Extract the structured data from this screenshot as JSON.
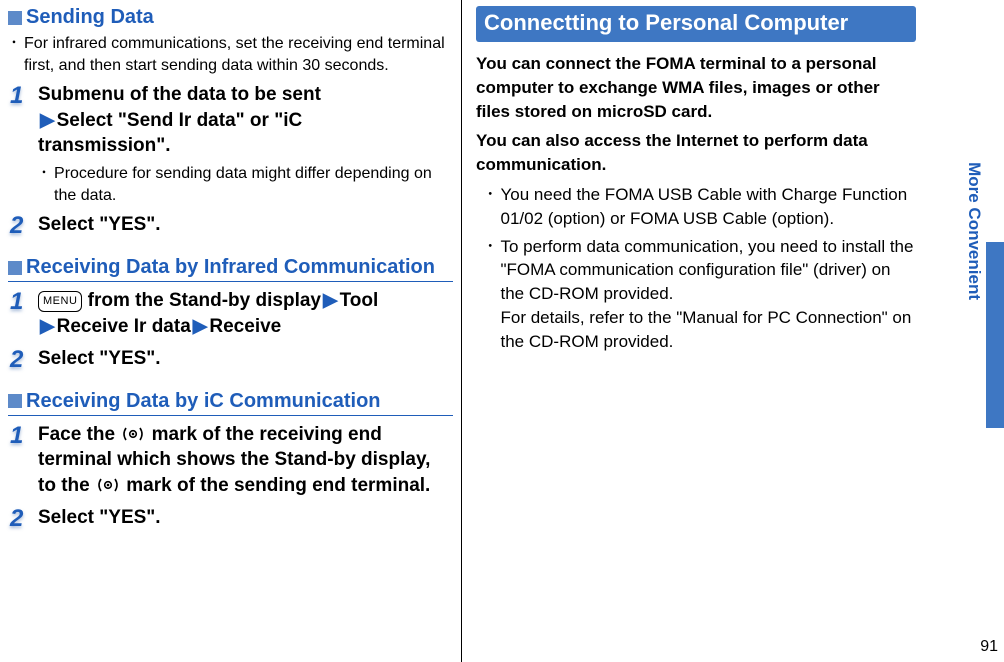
{
  "side": {
    "label": "More Convenient",
    "page": "91"
  },
  "left": {
    "sec1": {
      "title": "Sending Data",
      "note": "For infrared communications, set the receiving end terminal first, and then start sending data within 30 seconds.",
      "step1": {
        "line1": "Submenu of the data to be sent",
        "line2a": "Select \"Send Ir data\" or \"iC",
        "line2b": "transmission\".",
        "sub": "Procedure for sending data might differ depending on the data."
      },
      "step2": "Select \"YES\"."
    },
    "sec2": {
      "title": "Receiving Data by Infrared Communication",
      "step1": {
        "menu": "MENU",
        "a": " from the Stand-by display",
        "b": "Tool",
        "c": "Receive Ir data",
        "d": "Receive"
      },
      "step2": "Select \"YES\"."
    },
    "sec3": {
      "title": "Receiving Data by iC Communication",
      "step1a": "Face the ",
      "step1b": " mark of the receiving end terminal which shows the Stand-by display, to the ",
      "step1c": " mark of the sending end terminal.",
      "step2": "Select \"YES\"."
    }
  },
  "right": {
    "title": "Connectting to Personal Computer",
    "p1": "You can connect the FOMA terminal to a personal computer to exchange WMA files, images or other files stored on microSD card.",
    "p2": "You can also access the Internet to perform data communication.",
    "b1": "You need the FOMA USB Cable with Charge Function 01/02 (option) or FOMA USB Cable (option).",
    "b2": "To perform data communication, you need to install the \"FOMA communication configuration file\" (driver) on the CD-ROM provided.",
    "b2sub": "For details, refer to the \"Manual for PC Connection\" on the CD-ROM provided."
  }
}
